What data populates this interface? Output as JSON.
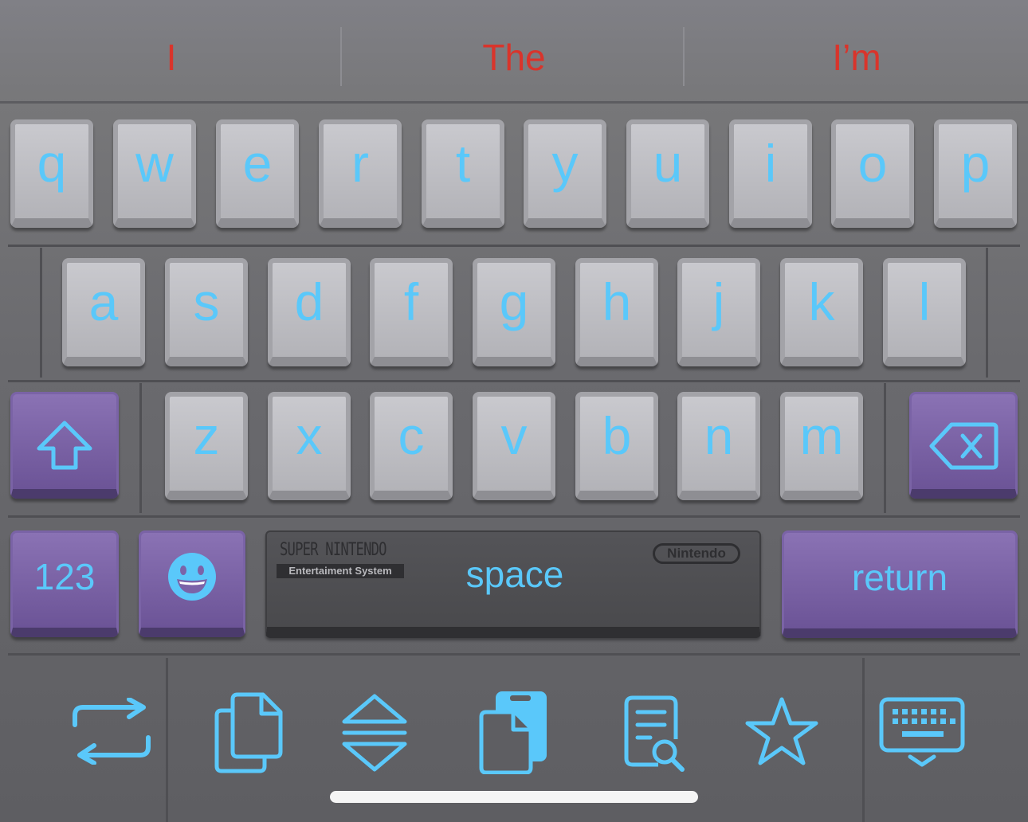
{
  "suggestions": [
    "I",
    "The",
    "I’m"
  ],
  "rows": {
    "row1": [
      "q",
      "w",
      "e",
      "r",
      "t",
      "y",
      "u",
      "i",
      "o",
      "p"
    ],
    "row2": [
      "a",
      "s",
      "d",
      "f",
      "g",
      "h",
      "j",
      "k",
      "l"
    ],
    "row3": [
      "z",
      "x",
      "c",
      "v",
      "b",
      "n",
      "m"
    ]
  },
  "keys": {
    "numbers_label": "123",
    "space_label": "space",
    "return_label": "return"
  },
  "space_branding": {
    "line1": "SUPER NINTENDO",
    "line2": "Entertaiment System",
    "badge": "Nintendo"
  },
  "toolbar": {
    "icons": [
      "switch-arrows-icon",
      "copy-icon",
      "expand-collapse-icon",
      "clipboard-icon",
      "document-search-icon",
      "star-icon",
      "keyboard-dismiss-icon"
    ]
  },
  "colors": {
    "suggestion_text": "#d9342b",
    "key_text": "#5ac8fa",
    "special_key": "#7b63a8",
    "letter_key": "#c2c2c7"
  }
}
